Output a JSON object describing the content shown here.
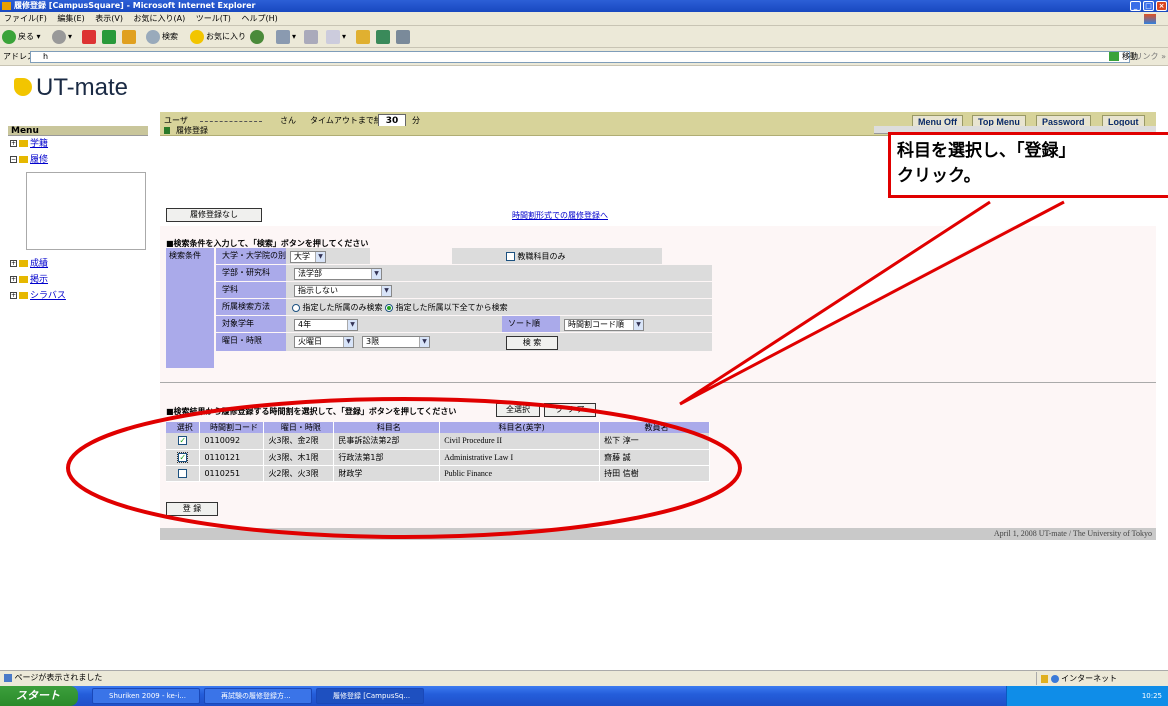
{
  "window": {
    "title": "履修登録 [CampusSquare] - Microsoft Internet Explorer"
  },
  "menubar": {
    "items": [
      "ファイル(F)",
      "編集(E)",
      "表示(V)",
      "お気に入り(A)",
      "ツール(T)",
      "ヘルプ(H)"
    ]
  },
  "toolbar": {
    "back": "戻る",
    "search": "検索",
    "favorites": "お気に入り"
  },
  "address": {
    "label": "アドレス(D)",
    "value": "h",
    "go": "移動",
    "links": "リンク »"
  },
  "header": {
    "logo": "UT-mate",
    "user_label": "ユーザ",
    "san": "さん",
    "timeout_label": "タイムアウトまで約",
    "timeout_value": "30",
    "timeout_unit": "分",
    "buttons": [
      "Menu Off",
      "Top Menu",
      "Password",
      "Logout"
    ]
  },
  "menu": {
    "title": "Menu",
    "items": [
      "学籍",
      "履修",
      "成績",
      "掲示",
      "シラバス"
    ]
  },
  "section": {
    "title": "履修登録"
  },
  "callout": {
    "line1": "科目を選択し、「登録」",
    "line2": "クリック。"
  },
  "actions": {
    "no_registration": "履修登録なし",
    "timetable_link": "時間割形式での履修登録へ"
  },
  "search": {
    "heading": "■検索条件を入力して、「検索」ボタンを押してください",
    "label": "検索条件",
    "rows": [
      {
        "label": "大学・大学院の別",
        "value": "大学"
      },
      {
        "label": "学部・研究科",
        "value": "法学部"
      },
      {
        "label": "学科",
        "value": "指示しない"
      },
      {
        "label": "所属検索方法",
        "opt1": "指定した所属のみ検索",
        "opt2": "指定した所属以下全てから検索",
        "selected": 2
      },
      {
        "label": "対象学年",
        "value": "4年"
      },
      {
        "label": "曜日・時限",
        "day": "火曜日",
        "period": "3限"
      }
    ],
    "teaching_only": "教職科目のみ",
    "sort_label": "ソート順",
    "sort_value": "時間割コード順",
    "search_button": "検 索"
  },
  "results": {
    "heading": "■検索結果から履修登録する時間割を選択して、「登録」ボタンを押してください",
    "select_all": "全選択",
    "clear": "ク リ ア",
    "columns": [
      "選択",
      "時間割コード",
      "曜日・時限",
      "科目名",
      "科目名(英字)",
      "教員名"
    ],
    "rows": [
      {
        "checked": true,
        "code": "0110092",
        "time": "火3限、金2限",
        "name": "民事訴訟法第2部",
        "name_en": "Civil Procedure II",
        "teacher": "松下 淳一"
      },
      {
        "checked": true,
        "code": "0110121",
        "time": "火3限、木1限",
        "name": "行政法第1部",
        "name_en": "Administrative Law I",
        "teacher": "齋藤 誠"
      },
      {
        "checked": false,
        "code": "0110251",
        "time": "火2限、火3限",
        "name": "財政学",
        "name_en": "Public Finance",
        "teacher": "持田 信樹"
      }
    ],
    "register_button": "登 録"
  },
  "footer": {
    "text": "April 1, 2008 UT-mate / The University of Tokyo"
  },
  "status": {
    "text": "ページが表示されました",
    "zone": "インターネット"
  },
  "taskbar": {
    "start": "スタート",
    "tasks": [
      "Shuriken 2009 - ke-i...",
      "再試験の履修登録方...",
      "履修登録 [CampusSq..."
    ],
    "clock": "10:25"
  }
}
